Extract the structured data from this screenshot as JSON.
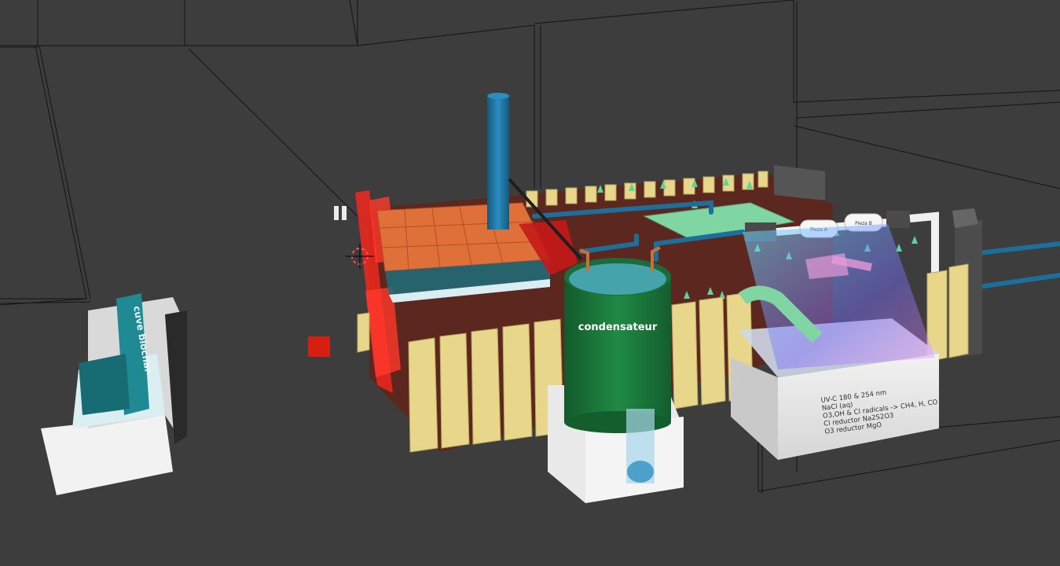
{
  "viewport": {
    "background": "#3d3d3d",
    "wire_color": "#0d0d0d"
  },
  "biochar_box": {
    "label": "cuve biochar",
    "color": "#1f8a93"
  },
  "condenser": {
    "label": "condensateur",
    "color": "#1f7a3c"
  },
  "uv_module": {
    "lines": [
      "UV-C 180 & 254 nm",
      "NaCl (aq)",
      "O3,OH & Cl radicals -> CH4, H, CO",
      "Cl reductor Na2S2O3",
      "O3 reductor MgO"
    ]
  },
  "pipe_fittings": [
    {
      "label": "Pieza A"
    },
    {
      "label": "Pieza B"
    }
  ],
  "colors": {
    "brick": "#e0703a",
    "slat": "#e8d68a",
    "soil": "#5a2a22",
    "red_panel": "#e8281e",
    "pipe": "#1d6f9b",
    "pad": "#7fd6a3"
  }
}
